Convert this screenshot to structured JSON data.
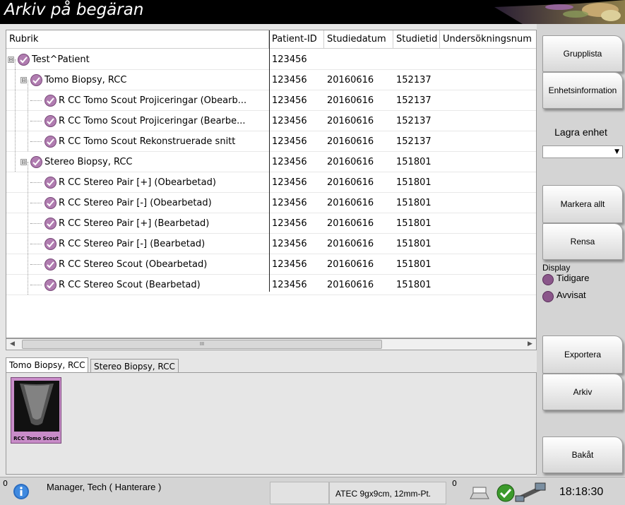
{
  "window": {
    "title": "Arkiv på begäran"
  },
  "grid": {
    "columns": [
      "Rubrik",
      "Patient-ID",
      "Studiedatum",
      "Studietid",
      "Undersökningsnum"
    ],
    "rows": [
      {
        "level": 0,
        "label": "Test^Patient",
        "patient_id": "123456",
        "date": "",
        "time": "",
        "expander": "⊟"
      },
      {
        "level": 1,
        "label": "Tomo Biopsy, RCC",
        "patient_id": "123456",
        "date": "20160616",
        "time": "152137",
        "expander": "⊟"
      },
      {
        "level": 2,
        "label": "R CC Tomo Scout  Projiceringar (Obearb...",
        "patient_id": "123456",
        "date": "20160616",
        "time": "152137"
      },
      {
        "level": 2,
        "label": "R CC Tomo Scout  Projiceringar (Bearbe...",
        "patient_id": "123456",
        "date": "20160616",
        "time": "152137"
      },
      {
        "level": 2,
        "label": "R CC Tomo Scout  Rekonstruerade snitt",
        "patient_id": "123456",
        "date": "20160616",
        "time": "152137"
      },
      {
        "level": 1,
        "label": "Stereo Biopsy, RCC",
        "patient_id": "123456",
        "date": "20160616",
        "time": "151801",
        "expander": "⊟"
      },
      {
        "level": 2,
        "label": "R CC Stereo Pair [+]  (Obearbetad)",
        "patient_id": "123456",
        "date": "20160616",
        "time": "151801"
      },
      {
        "level": 2,
        "label": "R CC Stereo Pair [-]  (Obearbetad)",
        "patient_id": "123456",
        "date": "20160616",
        "time": "151801"
      },
      {
        "level": 2,
        "label": "R CC Stereo Pair [+]  (Bearbetad)",
        "patient_id": "123456",
        "date": "20160616",
        "time": "151801"
      },
      {
        "level": 2,
        "label": "R CC Stereo Pair [-]  (Bearbetad)",
        "patient_id": "123456",
        "date": "20160616",
        "time": "151801"
      },
      {
        "level": 2,
        "label": "R CC Stereo Scout   (Obearbetad)",
        "patient_id": "123456",
        "date": "20160616",
        "time": "151801"
      },
      {
        "level": 2,
        "label": "R CC Stereo Scout   (Bearbetad)",
        "patient_id": "123456",
        "date": "20160616",
        "time": "151801"
      }
    ],
    "scroll_glyph": "III"
  },
  "tabs": [
    {
      "label": "Tomo Biopsy, RCC",
      "active": true
    },
    {
      "label": "Stereo Biopsy, RCC",
      "active": false
    }
  ],
  "thumbnail": {
    "caption": "RCC Tomo Scout"
  },
  "sidebar": {
    "group_list": "Grupplista",
    "device_info": "Enhetsinformation",
    "store_device_title": "Lagra enhet",
    "store_device_value": "",
    "select_all": "Markera allt",
    "clear": "Rensa",
    "display_title": "Display",
    "radio_previous": "Tidigare",
    "radio_rejected": "Avvisat",
    "export": "Exportera",
    "archive": "Arkiv",
    "back": "Bakåt"
  },
  "status": {
    "left_count": "0",
    "user": "Manager, Tech ( Hanterare )",
    "paddle": "ATEC 9gx9cm, 12mm-Pt.",
    "right_count": "0",
    "clock": "18:18:30"
  },
  "colors": {
    "check": "#b07cb0",
    "thumb": "#c88cc8",
    "titlebar": "#000000"
  }
}
